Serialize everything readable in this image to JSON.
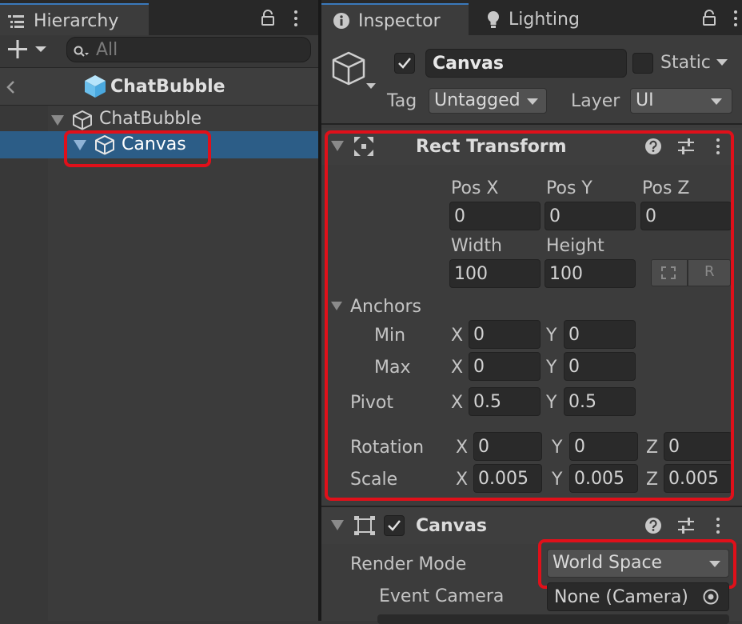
{
  "hierarchy": {
    "tab_label": "Hierarchy",
    "search_placeholder": "All",
    "scene_title": "ChatBubble",
    "items": [
      {
        "label": "ChatBubble"
      },
      {
        "label": "Canvas"
      }
    ]
  },
  "inspector": {
    "tab_label": "Inspector",
    "lighting_tab_label": "Lighting",
    "object_name": "Canvas",
    "static_label": "Static",
    "tag_label": "Tag",
    "tag_value": "Untagged",
    "layer_label": "Layer",
    "layer_value": "UI"
  },
  "rect_transform": {
    "title": "Rect Transform",
    "pos_x_label": "Pos X",
    "pos_y_label": "Pos Y",
    "pos_z_label": "Pos Z",
    "pos_x": "0",
    "pos_y": "0",
    "pos_z": "0",
    "width_label": "Width",
    "height_label": "Height",
    "width": "100",
    "height": "100",
    "r_button": "R",
    "anchors_label": "Anchors",
    "min_label": "Min",
    "max_label": "Max",
    "pivot_label": "Pivot",
    "x_label": "X",
    "y_label": "Y",
    "z_label": "Z",
    "min_x": "0",
    "min_y": "0",
    "max_x": "0",
    "max_y": "0",
    "pivot_x": "0.5",
    "pivot_y": "0.5",
    "rotation_label": "Rotation",
    "rot_x": "0",
    "rot_y": "0",
    "rot_z": "0",
    "scale_label": "Scale",
    "scale_x": "0.005",
    "scale_y": "0.005",
    "scale_z": "0.005"
  },
  "canvas_component": {
    "title": "Canvas",
    "render_mode_label": "Render Mode",
    "render_mode_value": "World Space",
    "event_camera_label": "Event Camera",
    "event_camera_value": "None (Camera)"
  },
  "colors": {
    "highlight": "#e0101a",
    "selection": "#2c5d87",
    "prefab_blue": "#8fd0f5"
  }
}
